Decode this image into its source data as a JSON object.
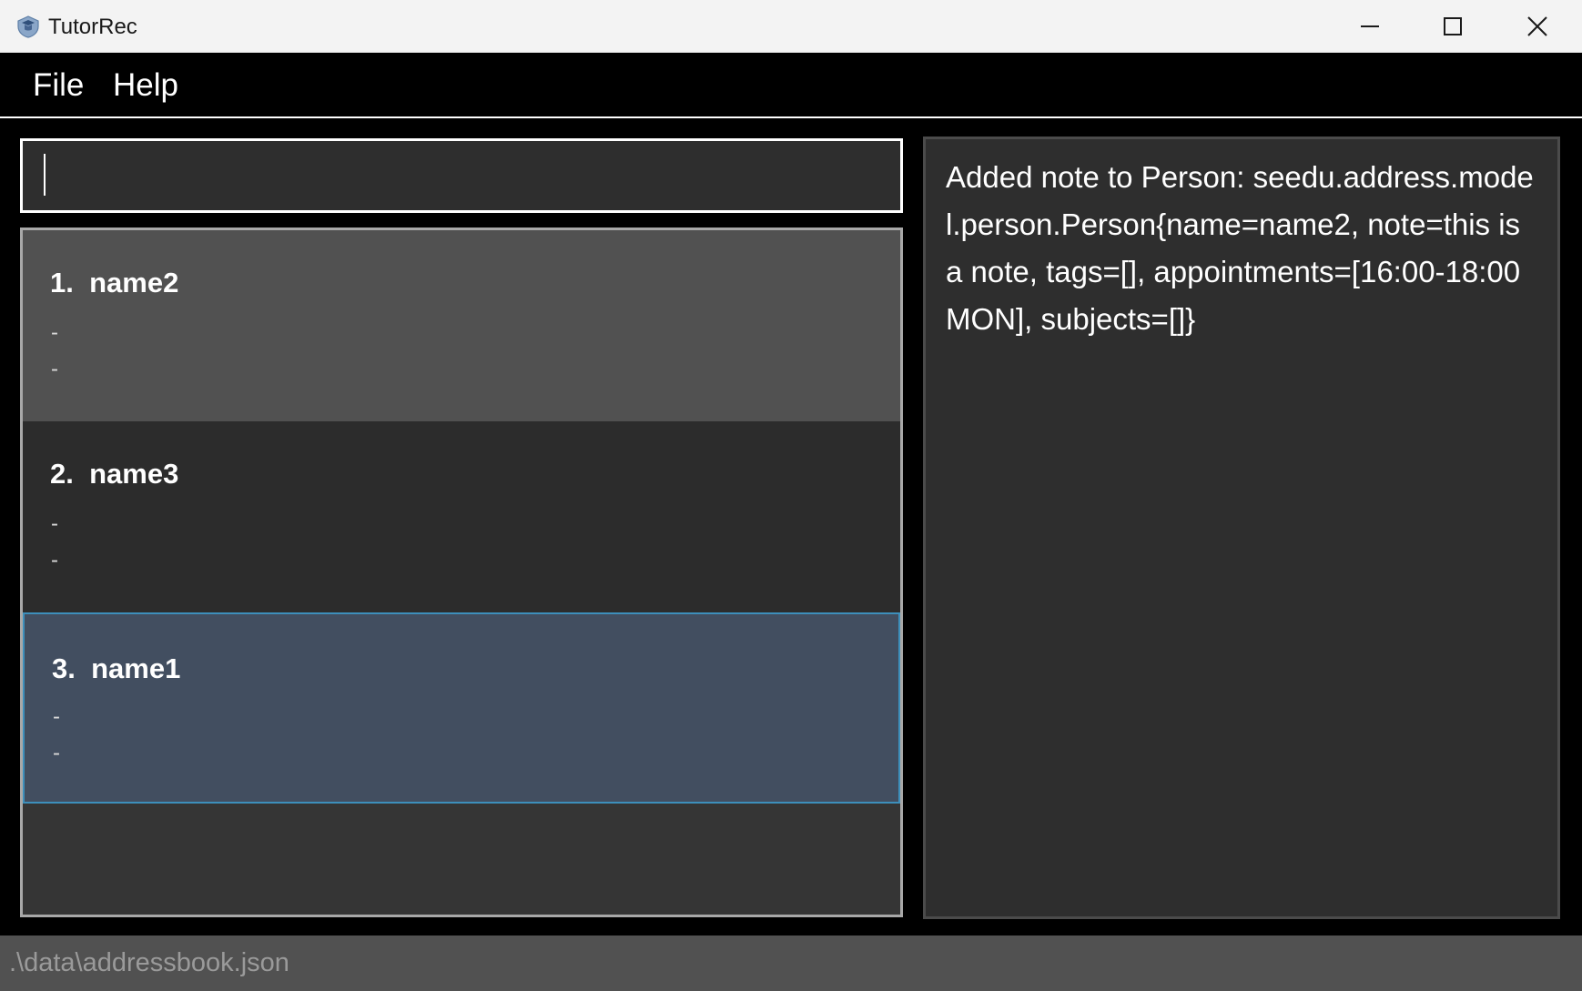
{
  "window": {
    "title": "TutorRec",
    "icon": "app-icon",
    "controls": {
      "minimize": "minimize-icon",
      "maximize": "maximize-icon",
      "close": "close-icon"
    }
  },
  "menu": {
    "file": "File",
    "help": "Help"
  },
  "command": {
    "value": "",
    "placeholder": ""
  },
  "persons": [
    {
      "index": "1.",
      "name": "name2",
      "line1": "-",
      "line2": "-"
    },
    {
      "index": "2.",
      "name": "name3",
      "line1": "-",
      "line2": "-"
    },
    {
      "index": "3.",
      "name": "name1",
      "line1": "-",
      "line2": "-"
    }
  ],
  "result": {
    "text": "Added note to Person: seedu.address.model.person.Person{name=name2, note=this is a note, tags=[], appointments=[16:00-18:00 MON], subjects=[]}"
  },
  "status": {
    "path": ".\\data\\addressbook.json"
  },
  "colors": {
    "background": "#000000",
    "panel": "#2e2e2e",
    "card_default": "#515151",
    "card_selected": "#424e60",
    "selected_border": "#3d8fbb",
    "statusbar": "#515151"
  }
}
